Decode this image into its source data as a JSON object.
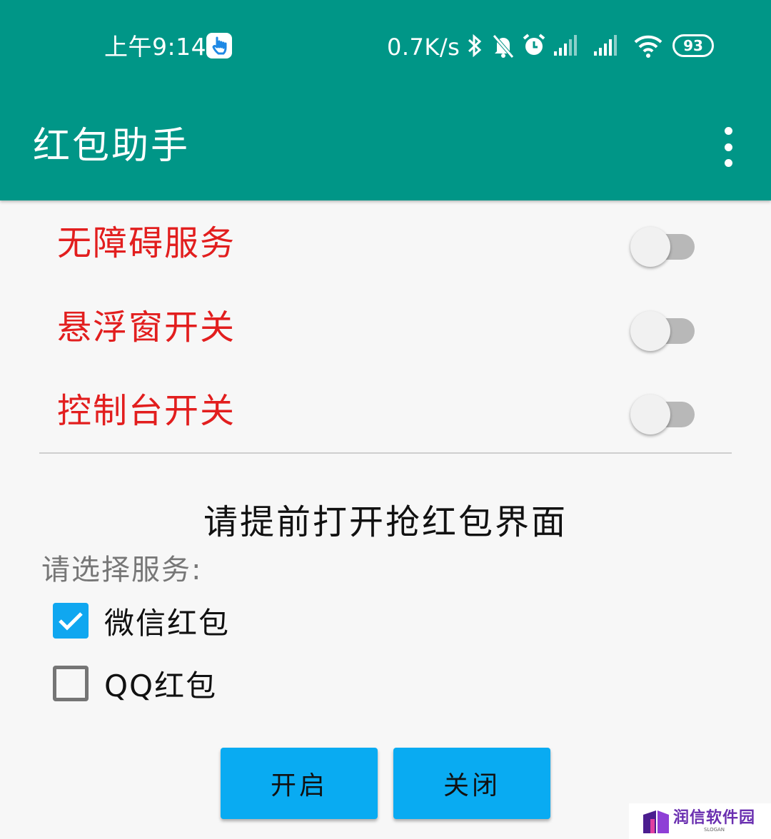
{
  "status_bar": {
    "time": "上午9:14",
    "net_speed": "0.7K/s",
    "battery": "93"
  },
  "app_bar": {
    "title": "红包助手"
  },
  "switches": [
    {
      "label": "无障碍服务",
      "on": false
    },
    {
      "label": "悬浮窗开关",
      "on": false
    },
    {
      "label": "控制台开关",
      "on": false
    }
  ],
  "hint": "请提前打开抢红包界面",
  "service_select": {
    "label": "请选择服务:",
    "options": [
      {
        "label": "微信红包",
        "checked": true
      },
      {
        "label": "QQ红包",
        "checked": false
      }
    ]
  },
  "buttons": {
    "start": "开启",
    "close": "关闭"
  },
  "watermark": {
    "text": "润信软件园",
    "sub": "SLOGAN"
  },
  "colors": {
    "app_bar": "#009687",
    "switch_label": "#e21e1e",
    "button": "#09abf2",
    "checkbox_checked": "#10a7f0"
  }
}
